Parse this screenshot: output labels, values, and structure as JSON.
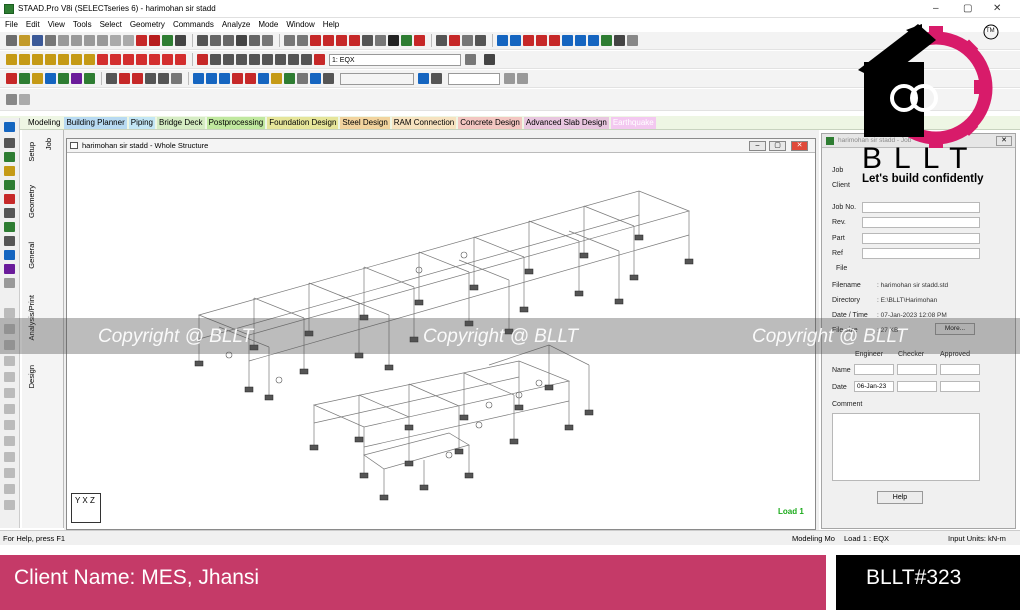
{
  "window": {
    "title": "STAAD.Pro V8i (SELECTseries 6) - harimohan sir stadd",
    "controls": [
      "–",
      "▢",
      "✕"
    ]
  },
  "menu": [
    "File",
    "Edit",
    "View",
    "Tools",
    "Select",
    "Geometry",
    "Commands",
    "Analyze",
    "Mode",
    "Window",
    "Help"
  ],
  "toolbar": {
    "load_case_combo": "1: EQX"
  },
  "mode_tabs": [
    {
      "label": "Modeling",
      "color": "#eef6e4"
    },
    {
      "label": "Building Planner",
      "color": "#b8daf2"
    },
    {
      "label": "Piping",
      "color": "#c3e6f5"
    },
    {
      "label": "Bridge Deck",
      "color": "#d5ecc3"
    },
    {
      "label": "Postprocessing",
      "color": "#c0e89f"
    },
    {
      "label": "Foundation Design",
      "color": "#e6e59a"
    },
    {
      "label": "Steel Design",
      "color": "#f2d39e"
    },
    {
      "label": "RAM Connection",
      "color": "#f6e2bf"
    },
    {
      "label": "Concrete Design",
      "color": "#f3c6c1"
    },
    {
      "label": "Advanced Slab Design",
      "color": "#e8c6df"
    },
    {
      "label": "Earthquake",
      "color": "#f3c8f0"
    }
  ],
  "page_control_tabs": [
    "Job",
    "Setup",
    "Geometry",
    "General",
    "Analysis/Print",
    "Design"
  ],
  "view": {
    "title": "harimohan sir stadd - Whole Structure",
    "load_label": "Load 1",
    "axis_triad": "Y X Z"
  },
  "job_panel": {
    "title": "harimohan sir stadd - Job",
    "labels": {
      "job": "Job",
      "client": "Client",
      "job_no": "Job No.",
      "rev": "Rev.",
      "part": "Part",
      "ref": "Ref",
      "file_group": "File",
      "filename": "Filename",
      "directory": "Directory",
      "date_time": "Date / Time",
      "file_size": "File size",
      "more_button": "More...",
      "engineer": "Engineer",
      "checker": "Checker",
      "approved": "Approved",
      "name": "Name",
      "date": "Date",
      "comment": "Comment",
      "help_button": "Help"
    },
    "values": {
      "filename": ": harimohan sir stadd.std",
      "directory": ": E:\\BLLT\\Harimohan",
      "date_time": ": 07-Jan-2023     12:08 PM",
      "file_size": ": 27 KB",
      "engineer_date": "06-Jan-23"
    }
  },
  "status": {
    "help": "For Help, press F1",
    "mode": "Modeling Mo",
    "load": "Load 1 : EQX",
    "units": "Input Units:  kN-m"
  },
  "watermark": [
    "Copyright @ BLLT",
    "Copyright @ BLLT",
    "Copyright @ BLLT"
  ],
  "logo": {
    "wordmark": "BLLT",
    "tagline": "Let's build confidently",
    "trademark": "TM",
    "accent": "#d81b6a"
  },
  "banner": {
    "client": "Client Name: MES, Jhansi",
    "code": "BLLT#323",
    "client_bg": "#c53a68",
    "code_bg": "#000000"
  }
}
